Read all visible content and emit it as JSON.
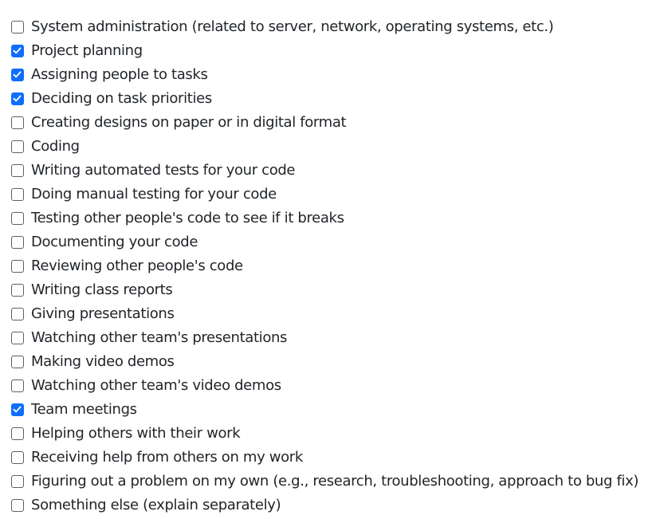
{
  "options": [
    {
      "label": "System administration (related to server, network, operating systems, etc.)",
      "checked": false
    },
    {
      "label": "Project planning",
      "checked": true
    },
    {
      "label": "Assigning people to tasks",
      "checked": true
    },
    {
      "label": "Deciding on task priorities",
      "checked": true
    },
    {
      "label": "Creating designs on paper or in digital format",
      "checked": false
    },
    {
      "label": "Coding",
      "checked": false
    },
    {
      "label": "Writing automated tests for your code",
      "checked": false
    },
    {
      "label": "Doing manual testing for your code",
      "checked": false
    },
    {
      "label": "Testing other people's code to see if it breaks",
      "checked": false
    },
    {
      "label": "Documenting your code",
      "checked": false
    },
    {
      "label": "Reviewing other people's code",
      "checked": false
    },
    {
      "label": "Writing class reports",
      "checked": false
    },
    {
      "label": "Giving presentations",
      "checked": false
    },
    {
      "label": "Watching other team's presentations",
      "checked": false
    },
    {
      "label": "Making video demos",
      "checked": false
    },
    {
      "label": "Watching other team's video demos",
      "checked": false
    },
    {
      "label": "Team meetings",
      "checked": true
    },
    {
      "label": "Helping others with their work",
      "checked": false
    },
    {
      "label": "Receiving help from others on my work",
      "checked": false
    },
    {
      "label": "Figuring out a problem on my own (e.g., research, troubleshooting, approach to bug fix)",
      "checked": false
    },
    {
      "label": "Something else (explain separately)",
      "checked": false
    }
  ]
}
